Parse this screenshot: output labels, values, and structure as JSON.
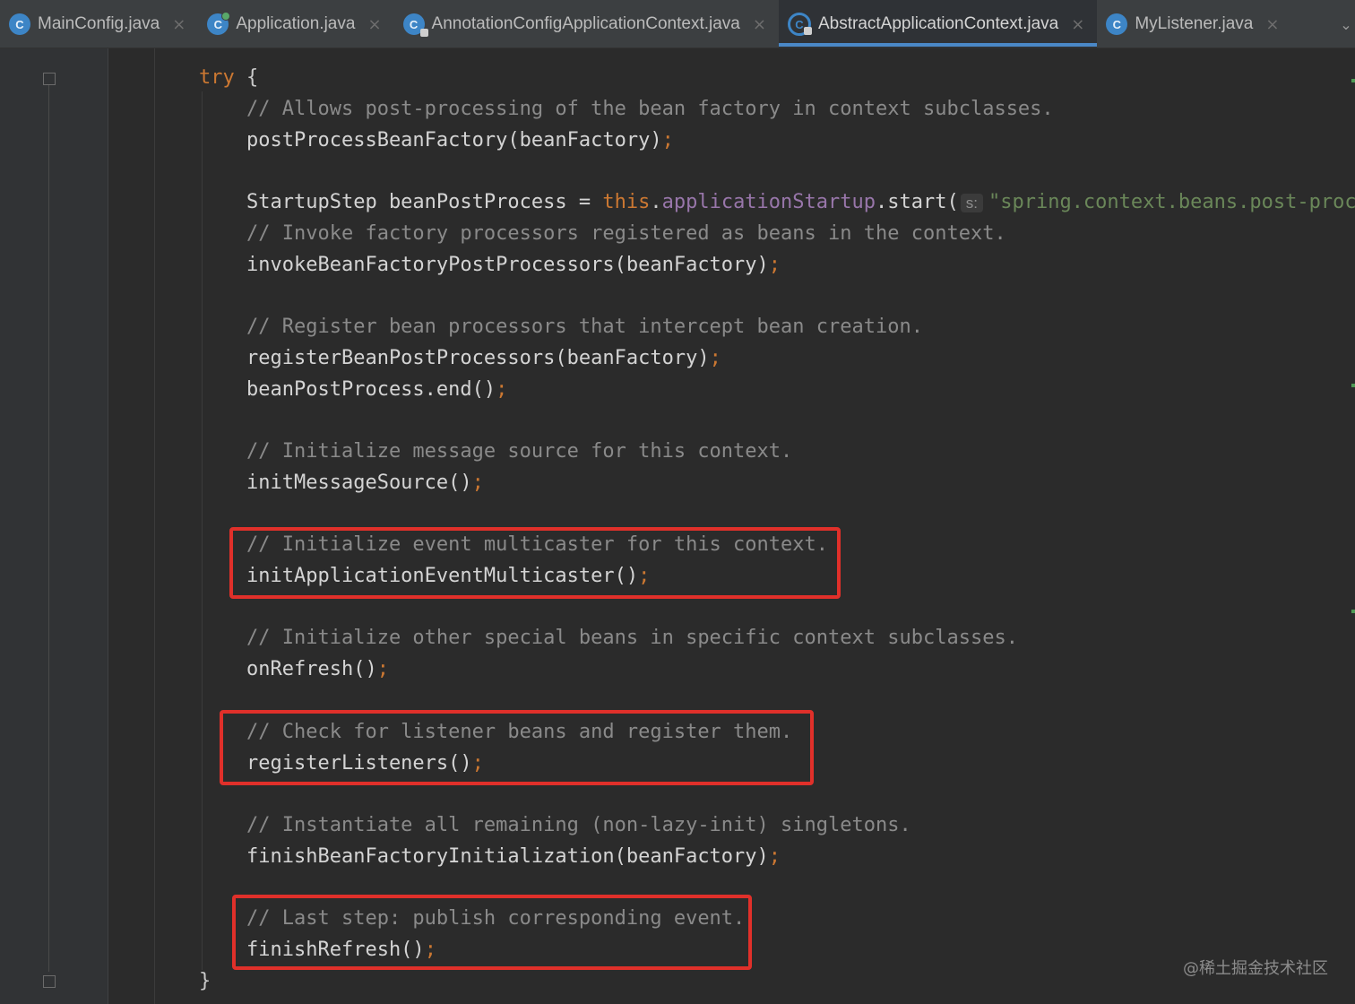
{
  "tabs": [
    {
      "label": "MainConfig.java",
      "icon": "class-icon",
      "active": false
    },
    {
      "label": "Application.java",
      "icon": "runnable-class-icon",
      "active": false
    },
    {
      "label": "AnnotationConfigApplicationContext.java",
      "icon": "locked-class-icon",
      "active": false
    },
    {
      "label": "AbstractApplicationContext.java",
      "icon": "abstract-class-icon",
      "active": true
    },
    {
      "label": "MyListener.java",
      "icon": "class-icon",
      "active": false
    }
  ],
  "tab_icon_letter": "C",
  "tab_close_glyph": "×",
  "tab_overflow_glyph": "⌄",
  "colors": {
    "keyword": "#cc7832",
    "comment": "#8a8a8a",
    "field": "#9876aa",
    "string": "#6a8759",
    "highlight_box": "#e0302a",
    "active_tab_underline": "#4a88c7"
  },
  "code": {
    "try_keyword": "try",
    "open_brace": " {",
    "close_brace": "}",
    "line_comment_allows": "// Allows post-processing of the bean factory in context subclasses.",
    "line_postprocess": "postProcessBeanFactory(beanFactory)",
    "startup_type": "StartupStep beanPostProcess = ",
    "startup_this": "this",
    "startup_dot": ".",
    "startup_field": "applicationStartup",
    "startup_call": ".start(",
    "startup_hint": "s:",
    "startup_string": "\"spring.context.beans.post-process\");",
    "line_comment_invoke": "// Invoke factory processors registered as beans in the context.",
    "line_invoke": "invokeBeanFactoryPostProcessors(beanFactory)",
    "line_comment_register": "// Register bean processors that intercept bean creation.",
    "line_register": "registerBeanPostProcessors(beanFactory)",
    "line_end": "beanPostProcess.end()",
    "line_comment_message": "// Initialize message source for this context.",
    "line_message": "initMessageSource()",
    "line_comment_multicaster": "// Initialize event multicaster for this context.",
    "line_multicaster": "initApplicationEventMulticaster()",
    "line_comment_other": "// Initialize other special beans in specific context subclasses.",
    "line_onrefresh": "onRefresh()",
    "line_comment_listeners": "// Check for listener beans and register them.",
    "line_listeners": "registerListeners()",
    "line_comment_instantiate": "// Instantiate all remaining (non-lazy-init) singletons.",
    "line_finishbean": "finishBeanFactoryInitialization(beanFactory)",
    "line_comment_last": "// Last step: publish corresponding event.",
    "line_finishrefresh": "finishRefresh()",
    "semicolon": ";"
  },
  "watermark": "@稀土掘金技术社区"
}
